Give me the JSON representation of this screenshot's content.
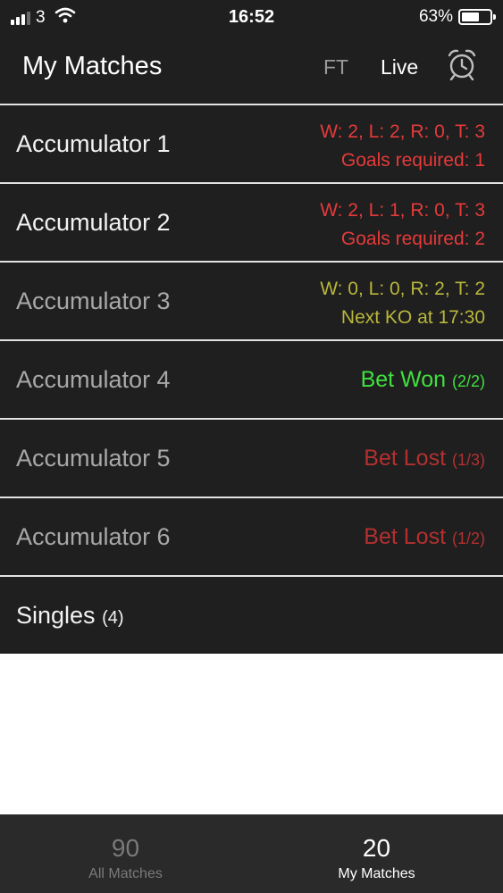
{
  "status_bar": {
    "carrier": "3",
    "time": "16:52",
    "battery_percent": "63%",
    "battery_level": 0.63,
    "icons": [
      "signal-icon",
      "wifi-icon",
      "battery-icon"
    ]
  },
  "header": {
    "title": "My Matches",
    "ft_label": "FT",
    "live_label": "Live",
    "alarm_icon": "alarm-clock-icon"
  },
  "rows": [
    {
      "label": "Accumulator 1",
      "line1": "W: 2, L: 2, R: 0, T: 3",
      "line2": "Goals required: 1"
    },
    {
      "label": "Accumulator 2",
      "line1": "W: 2, L: 1, R: 0, T: 3",
      "line2": "Goals required: 2"
    },
    {
      "label": "Accumulator 3",
      "line1": "W: 0, L: 0, R: 2, T: 2",
      "line2": "Next KO at 17:30"
    },
    {
      "label": "Accumulator 4",
      "result": "Bet Won",
      "count": "(2/2)"
    },
    {
      "label": "Accumulator 5",
      "result": "Bet Lost",
      "count": "(1/3)"
    },
    {
      "label": "Accumulator 6",
      "result": "Bet Lost",
      "count": "(1/2)"
    }
  ],
  "singles": {
    "label": "Singles",
    "count": "(4)"
  },
  "colors": {
    "active_red": "#e53a3a",
    "pending_yellow": "#b9b63b",
    "won_green": "#3fe03f",
    "lost_red": "#b43030",
    "background": "#1f1f1f"
  },
  "tabs": [
    {
      "count": "90",
      "label": "All Matches"
    },
    {
      "count": "20",
      "label": "My Matches"
    }
  ]
}
